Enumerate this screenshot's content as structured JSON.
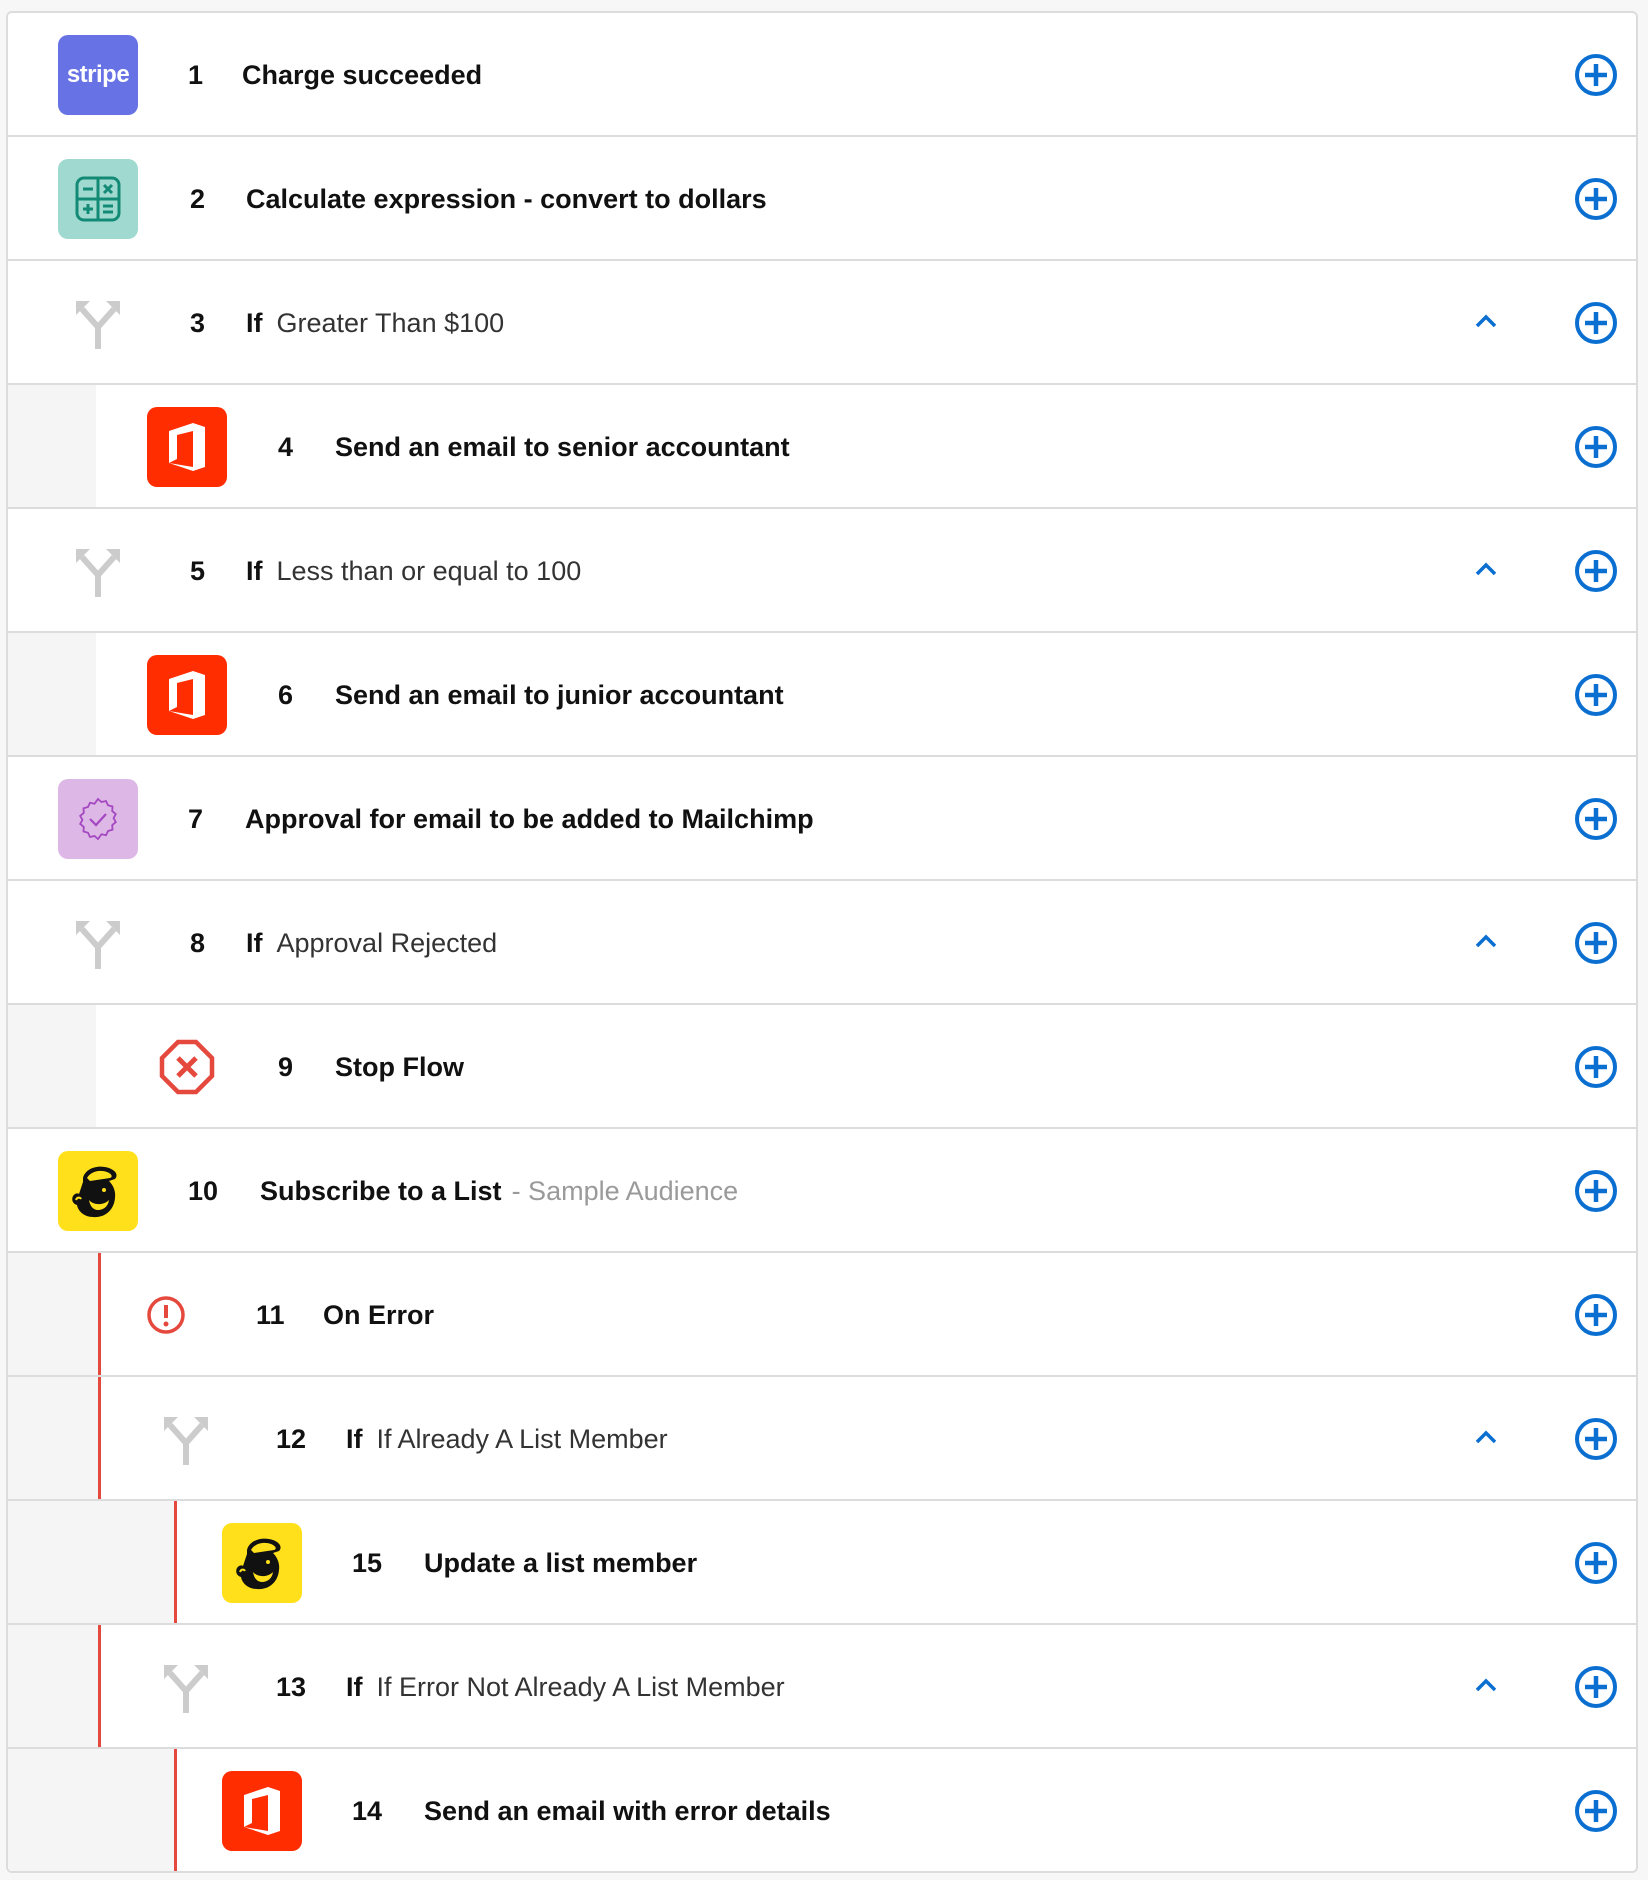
{
  "colors": {
    "accent_blue": "#0a6fd1",
    "error_red": "#e5483c",
    "stripe_bg": "#6772e5",
    "calc_bg": "#9fd9cf",
    "calc_fg": "#138a76",
    "office_bg": "#ff2d00",
    "approval_bg": "#ddb8e6",
    "approval_fg": "#a447c0",
    "mailchimp_bg": "#ffe01b",
    "branch_gray": "#cccccc"
  },
  "steps": [
    {
      "number": "1",
      "title": "Charge succeeded",
      "icon": "stripe-icon",
      "icon_label": "stripe"
    },
    {
      "number": "2",
      "title": "Calculate expression - convert to dollars",
      "icon": "calculator-icon"
    },
    {
      "number": "3",
      "keyword": "If",
      "condition": "Greater Than $100",
      "icon": "branch-icon",
      "collapsible": true
    },
    {
      "number": "4",
      "title": "Send an email to senior accountant",
      "icon": "office-icon"
    },
    {
      "number": "5",
      "keyword": "If",
      "condition": "Less than or equal to 100",
      "icon": "branch-icon",
      "collapsible": true
    },
    {
      "number": "6",
      "title": "Send an email to junior accountant",
      "icon": "office-icon"
    },
    {
      "number": "7",
      "title": "Approval for email to be added to Mailchimp",
      "icon": "approval-badge-icon"
    },
    {
      "number": "8",
      "keyword": "If",
      "condition": "Approval Rejected",
      "icon": "branch-icon",
      "collapsible": true
    },
    {
      "number": "9",
      "title": "Stop Flow",
      "icon": "stop-icon"
    },
    {
      "number": "10",
      "title": "Subscribe to a List",
      "subtitle": "- Sample Audience",
      "icon": "mailchimp-icon"
    },
    {
      "number": "11",
      "title": "On Error",
      "icon": "error-alert-icon"
    },
    {
      "number": "12",
      "keyword": "If",
      "condition": "If Already A List Member",
      "icon": "branch-icon",
      "collapsible": true
    },
    {
      "number": "15",
      "title": "Update a list member",
      "icon": "mailchimp-icon"
    },
    {
      "number": "13",
      "keyword": "If",
      "condition": "If Error Not Already A List Member",
      "icon": "branch-icon",
      "collapsible": true
    },
    {
      "number": "14",
      "title": "Send an email with error details",
      "icon": "office-icon"
    }
  ],
  "actions": {
    "add_step_icon": "plus-circle-icon",
    "collapse_icon": "chevron-up-icon"
  }
}
